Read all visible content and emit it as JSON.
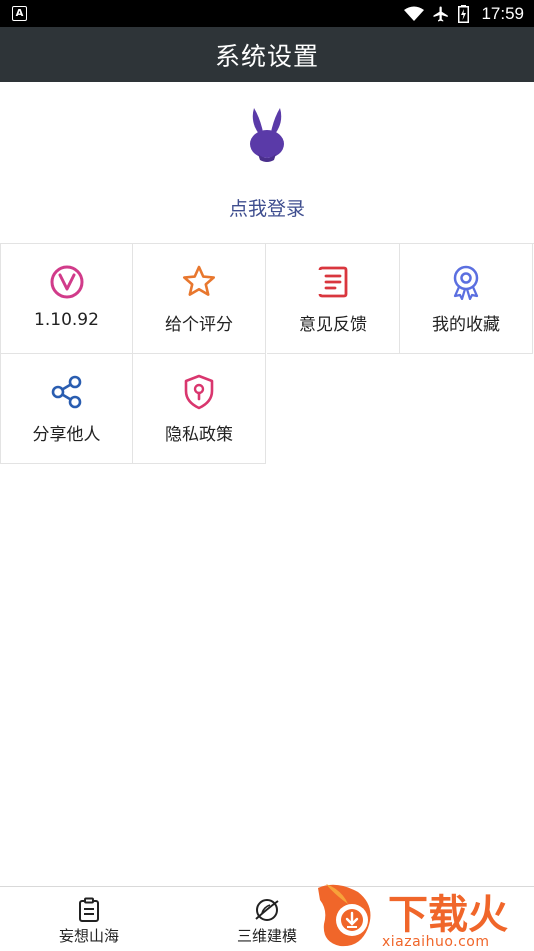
{
  "status_bar": {
    "time": "17:59"
  },
  "header": {
    "title": "系统设置"
  },
  "profile": {
    "login_label": "点我登录"
  },
  "grid": {
    "items": [
      {
        "label": "1.10.92",
        "icon": "version-icon",
        "color": "#d13b8a"
      },
      {
        "label": "给个评分",
        "icon": "star-icon",
        "color": "#e8772e"
      },
      {
        "label": "意见反馈",
        "icon": "feedback-icon",
        "color": "#d9363e"
      },
      {
        "label": "我的收藏",
        "icon": "badge-icon",
        "color": "#5b6fe0"
      },
      {
        "label": "分享他人",
        "icon": "share-icon",
        "color": "#2a5db0"
      },
      {
        "label": "隐私政策",
        "icon": "shield-lock-icon",
        "color": "#d9366e"
      }
    ]
  },
  "bottom_nav": {
    "items": [
      {
        "label": "妄想山海",
        "icon": "clipboard-icon"
      },
      {
        "label": "三维建模",
        "icon": "planet-icon"
      }
    ]
  },
  "watermark": {
    "brand": "下载火",
    "domain": "xiazaihuo.com"
  }
}
